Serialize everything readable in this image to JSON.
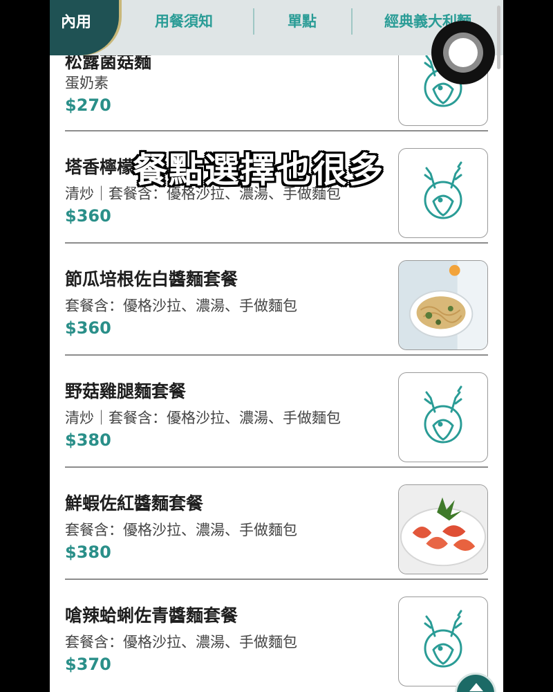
{
  "tabs": {
    "active": "內用",
    "items": [
      "用餐須知",
      "單點",
      "經典義大利麵"
    ]
  },
  "overlay_caption": "餐點選擇也很多",
  "menu": [
    {
      "title": "松露菌菇麵",
      "desc": "蛋奶素",
      "price": "$270",
      "image": "placeholder"
    },
    {
      "title": "塔香檸檬",
      "desc": "清炒｜套餐含：優格沙拉、濃湯、手做麵包",
      "price": "$360",
      "image": "placeholder"
    },
    {
      "title": "節瓜培根佐白醬麵套餐",
      "desc": "套餐含：優格沙拉、濃湯、手做麵包",
      "price": "$360",
      "image": "photo-pasta"
    },
    {
      "title": "野菇雞腿麵套餐",
      "desc": "清炒｜套餐含：優格沙拉、濃湯、手做麵包",
      "price": "$380",
      "image": "placeholder"
    },
    {
      "title": "鮮蝦佐紅醬麵套餐",
      "desc": "套餐含：優格沙拉、濃湯、手做麵包",
      "price": "$380",
      "image": "photo-shrimp"
    },
    {
      "title": "嗆辣蛤蜊佐青醬麵套餐",
      "desc": "套餐含：優格沙拉、濃湯、手做麵包",
      "price": "$370",
      "image": "placeholder"
    }
  ],
  "colors": {
    "brand_dark": "#1f5254",
    "accent_teal": "#2a8f89",
    "gold": "#c9b87a"
  }
}
